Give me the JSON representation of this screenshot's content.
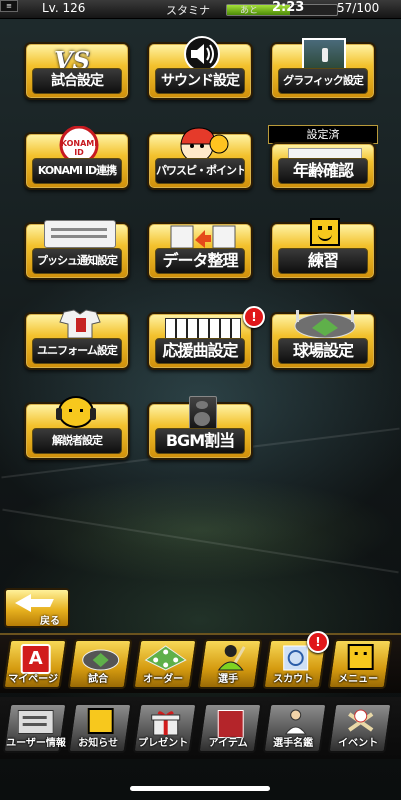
{
  "status_bar": {
    "corner": "≡",
    "level": "Lv. 126",
    "stamina_label": "スタミナ",
    "remaining_label": "あと",
    "timer": "2:23",
    "stamina_count": "57/100",
    "stamina_fraction": 0.57
  },
  "menu": {
    "match_settings": "試合設定",
    "sound_settings": "サウンド設定",
    "graphic_settings": "グラフィック設定",
    "konami_link": "KONAMI ID連携",
    "konami_logo_text": "KONAMI ID",
    "pawapoint": "パワスピ・ポイント",
    "age_confirm": "年齢確認",
    "age_status": "設定済",
    "push_settings": "プッシュ通知設定",
    "data_organize": "データ整理",
    "practice": "練習",
    "uniform_settings": "ユニフォーム設定",
    "cheer_song": "応援曲設定",
    "stadium_settings": "球場設定",
    "commentator_settings": "解説者設定",
    "bgm_assign": "BGM割当",
    "vs_logo": "VS",
    "notice_mark": "!"
  },
  "back_button": {
    "label": "戻る"
  },
  "nav_top": [
    {
      "label": "マイページ",
      "icon": "a-logo-icon"
    },
    {
      "label": "試合",
      "icon": "stadium-icon"
    },
    {
      "label": "オーダー",
      "icon": "lineup-icon"
    },
    {
      "label": "選手",
      "icon": "player-icon"
    },
    {
      "label": "スカウト",
      "icon": "scout-icon",
      "badge": "!"
    },
    {
      "label": "メニュー",
      "icon": "menu-icon"
    }
  ],
  "nav_bottom": [
    {
      "label": "ユーザー情報",
      "icon": "user-card-icon"
    },
    {
      "label": "お知らせ",
      "icon": "notice-icon"
    },
    {
      "label": "プレゼント",
      "icon": "gift-icon"
    },
    {
      "label": "アイテム",
      "icon": "item-icon"
    },
    {
      "label": "選手名鑑",
      "icon": "player-book-icon"
    },
    {
      "label": "イベント",
      "icon": "event-icon"
    }
  ],
  "colors": {
    "tile_gold": "#f3c22e",
    "badge_red": "#e0171a",
    "stamina_green": "#7cbf1e"
  }
}
